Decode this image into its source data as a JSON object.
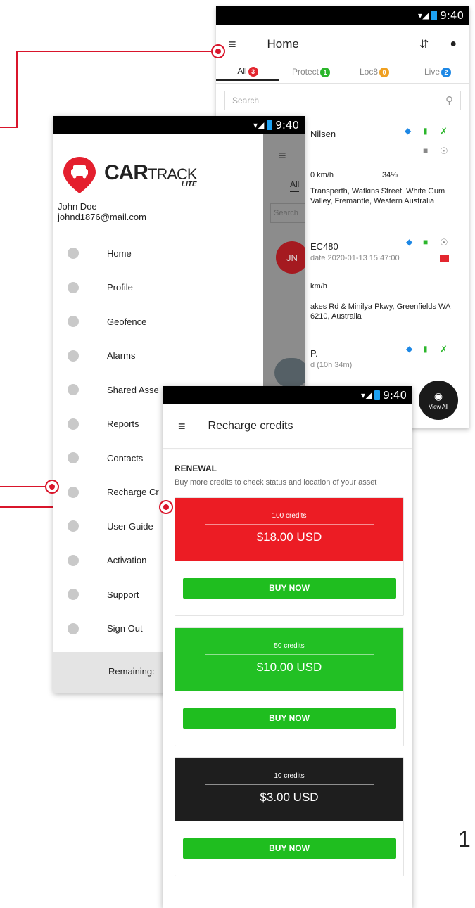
{
  "status": {
    "time": "9:40"
  },
  "home": {
    "title": "Home",
    "tabs": [
      {
        "label": "All",
        "count": "3",
        "color": "#e3262f"
      },
      {
        "label": "Protect",
        "count": "1",
        "color": "#2bb62b"
      },
      {
        "label": "Loc8",
        "count": "0",
        "color": "#f0a020"
      },
      {
        "label": "Live",
        "count": "2",
        "color": "#1e88e5"
      }
    ],
    "search_placeholder": "Search",
    "assets": [
      {
        "name": "Nilsen",
        "speed": "0 km/h",
        "battery": "34%",
        "address": "Transperth, Watkins Street, White Gum Valley, Fremantle, Western Australia"
      },
      {
        "name": "EC480",
        "initials": "JN",
        "update": "date 2020-01-13 15:47:00",
        "speed": "km/h",
        "address": "akes Rd & Minilya Pkwy, Greenfields WA 6210, Australia"
      },
      {
        "name": "P.",
        "duration": "d (10h 34m)"
      }
    ],
    "view_all_label": "View All"
  },
  "drawer": {
    "logo_main": "CAR",
    "logo_light": "TRACK",
    "logo_sub": "LITE",
    "user_name": "John Doe",
    "user_email": "johnd1876@mail.com",
    "items": [
      {
        "label": "Home"
      },
      {
        "label": "Profile"
      },
      {
        "label": "Geofence"
      },
      {
        "label": "Alarms"
      },
      {
        "label": "Shared Asse"
      },
      {
        "label": "Reports"
      },
      {
        "label": "Contacts"
      },
      {
        "label": "Recharge Cr"
      },
      {
        "label": "User Guide"
      },
      {
        "label": "Activation"
      },
      {
        "label": "Support"
      },
      {
        "label": "Sign Out"
      }
    ],
    "remaining_label": "Remaining:",
    "scrim_tab": "All",
    "scrim_search": "Search"
  },
  "recharge": {
    "title": "Recharge credits",
    "section_title": "RENEWAL",
    "section_desc": "Buy more credits to check status and location of your asset",
    "cards": [
      {
        "credits": "100 credits",
        "price": "$18.00 USD",
        "button": "BUY NOW",
        "color": "#ec1c24"
      },
      {
        "credits": "50 credits",
        "price": "$10.00 USD",
        "button": "BUY NOW",
        "color": "#22c024"
      },
      {
        "credits": "10 credits",
        "price": "$3.00 USD",
        "button": "BUY NOW",
        "color": "#1e1e1e"
      }
    ]
  },
  "page_number": "1",
  "colors": {
    "accent": "#d9152b",
    "buy": "#1fbe1f"
  }
}
